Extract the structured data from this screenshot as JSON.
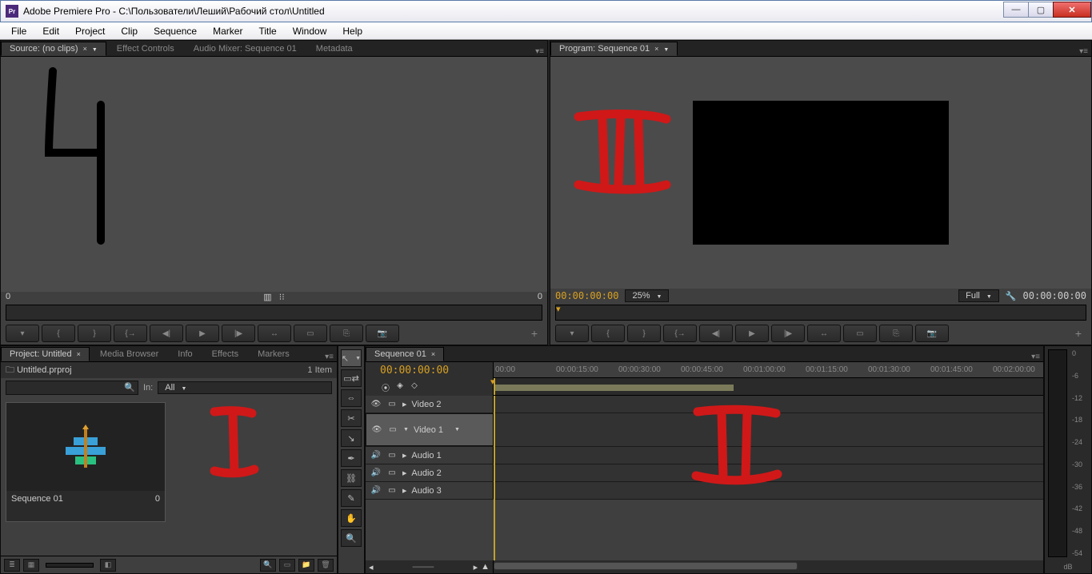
{
  "window": {
    "title": "Adobe Premiere Pro - C:\\Пользователи\\Леший\\Рабочий стол\\Untitled",
    "min": "—",
    "max": "▢",
    "close": "✕"
  },
  "menu": [
    "File",
    "Edit",
    "Project",
    "Clip",
    "Sequence",
    "Marker",
    "Title",
    "Window",
    "Help"
  ],
  "source": {
    "tabs": {
      "source": "Source: (no clips)",
      "fx": "Effect Controls",
      "mixer": "Audio Mixer: Sequence 01",
      "meta": "Metadata"
    },
    "ruler_left": "0",
    "ruler_right": "0",
    "ctrls": [
      "▾",
      "{",
      "}",
      "{→",
      "◀|",
      "▶",
      "|▶",
      "↔",
      "▭",
      "⎘",
      "📷"
    ]
  },
  "program": {
    "tab": "Program: Sequence 01",
    "tc": "00:00:00:00",
    "zoom": "25%",
    "fit": "Full",
    "tc_right": "00:00:00:00",
    "settings_icon": "🔧",
    "ctrls": [
      "▾",
      "{",
      "}",
      "{→",
      "◀|",
      "▶",
      "|▶",
      "↔",
      "▭",
      "⎘",
      "📷"
    ]
  },
  "project": {
    "tabs": [
      "Project: Untitled",
      "Media Browser",
      "Info",
      "Effects",
      "Markers"
    ],
    "file": "Untitled.prproj",
    "items": "1 Item",
    "search_placeholder": "",
    "in_label": "In:",
    "in_value": "All",
    "card_name": "Sequence 01",
    "card_dur": "0",
    "foot_icons": [
      "≣",
      "▦",
      "▤",
      "◧",
      "🔍",
      "▭",
      "📁",
      "🗑"
    ]
  },
  "tools": [
    "↖",
    "▭⇄",
    "⇔",
    "✂",
    "↘",
    "✒",
    "⛓",
    "✎",
    "✋",
    "🔍"
  ],
  "timeline": {
    "tab": "Sequence 01",
    "tc": "00:00:00:00",
    "ruler": [
      "00:00",
      "00:00:15:00",
      "00:00:30:00",
      "00:00:45:00",
      "00:01:00:00",
      "00:01:15:00",
      "00:01:30:00",
      "00:01:45:00",
      "00:02:00:00"
    ],
    "tracks": [
      {
        "type": "video",
        "name": "Video 2",
        "eye": "👁",
        "lock": "▭",
        "exp": "▶"
      },
      {
        "type": "video",
        "name": "Video 1",
        "eye": "👁",
        "lock": "▭",
        "exp": "▼",
        "tall": true,
        "sel": true
      },
      {
        "type": "audio",
        "name": "Audio 1",
        "spk": "🔊",
        "lock": "▭",
        "exp": "▶"
      },
      {
        "type": "audio",
        "name": "Audio 2",
        "spk": "🔊",
        "lock": "▭",
        "exp": "▶"
      },
      {
        "type": "audio",
        "name": "Audio 3",
        "spk": "🔊",
        "lock": "▭",
        "exp": "▶"
      }
    ],
    "zoom_icons": [
      "◂",
      "━━━━",
      "▸",
      "▲"
    ]
  },
  "meter": {
    "labels": [
      "0",
      "-6",
      "-12",
      "-18",
      "-24",
      "-30",
      "-36",
      "-42",
      "-48",
      "-54"
    ],
    "unit": "dB"
  }
}
